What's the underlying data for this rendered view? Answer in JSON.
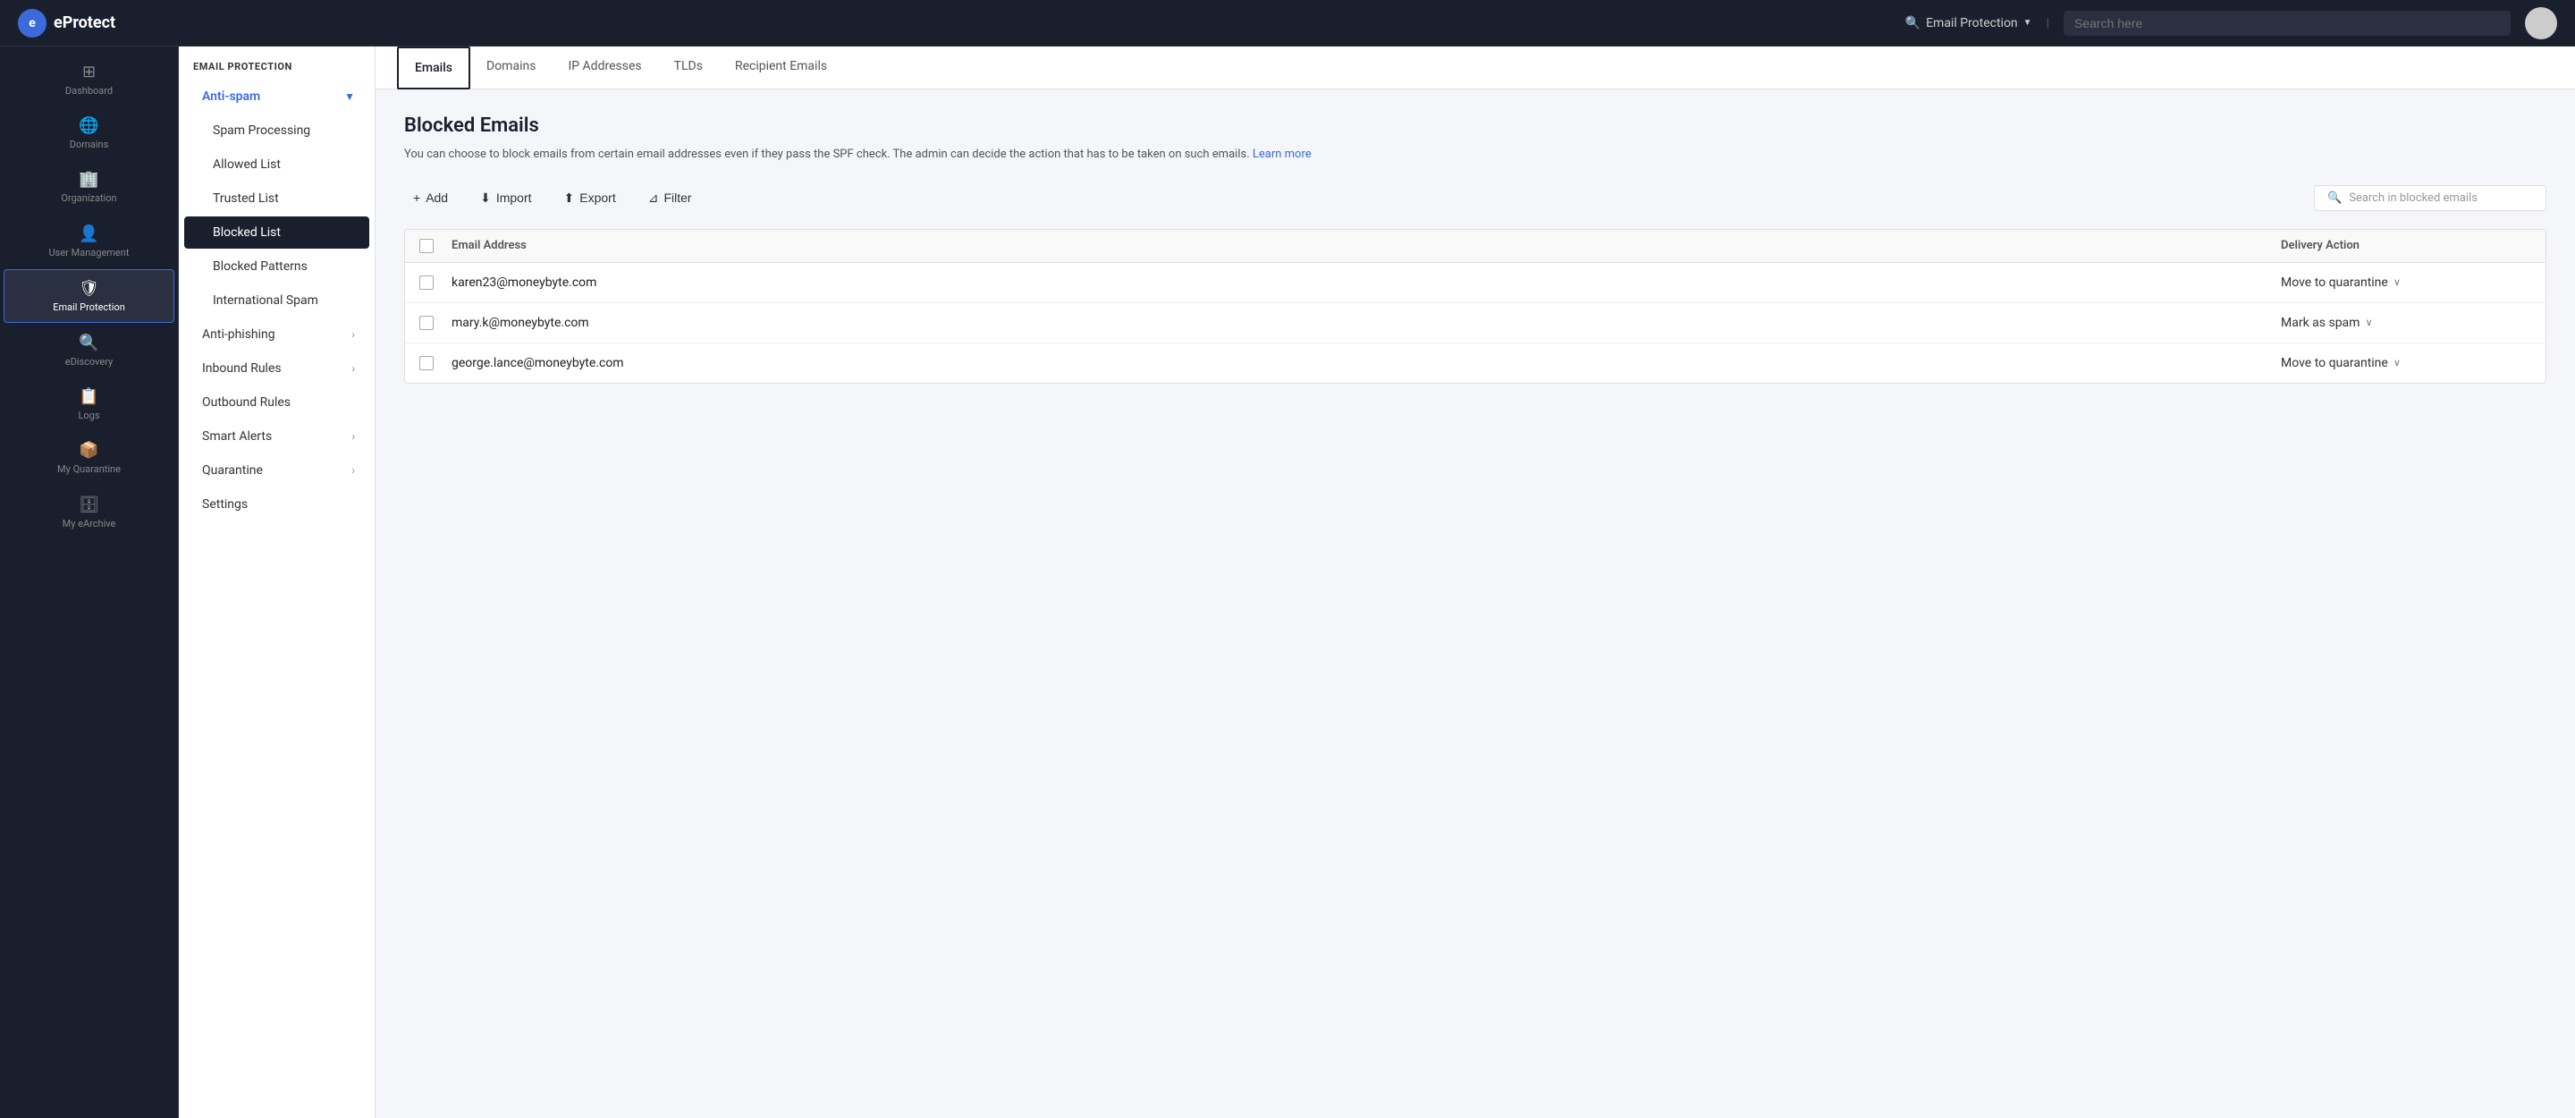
{
  "app": {
    "name": "eProtect",
    "logo_char": "e"
  },
  "topnav": {
    "search_context": "Email Protection",
    "search_placeholder": "Search here"
  },
  "sidebar": {
    "items": [
      {
        "id": "dashboard",
        "label": "Dashboard",
        "icon": "⊞"
      },
      {
        "id": "domains",
        "label": "Domains",
        "icon": "🌐"
      },
      {
        "id": "organization",
        "label": "Organization",
        "icon": "🏢"
      },
      {
        "id": "user-management",
        "label": "User Management",
        "icon": "👤"
      },
      {
        "id": "email-protection",
        "label": "Email Protection",
        "icon": "🛡",
        "active": true
      },
      {
        "id": "ediscovery",
        "label": "eDiscovery",
        "icon": "🔍"
      },
      {
        "id": "logs",
        "label": "Logs",
        "icon": "📋"
      },
      {
        "id": "my-quarantine",
        "label": "My Quarantine",
        "icon": "📦"
      },
      {
        "id": "my-earchive",
        "label": "My eArchive",
        "icon": "🗄"
      }
    ]
  },
  "sub_sidebar": {
    "section_title": "EMAIL PROTECTION",
    "items": [
      {
        "id": "anti-spam",
        "label": "Anti-spam",
        "is_parent": true,
        "expanded": true
      },
      {
        "id": "spam-processing",
        "label": "Spam Processing",
        "indent": true
      },
      {
        "id": "allowed-list",
        "label": "Allowed List",
        "indent": true
      },
      {
        "id": "trusted-list",
        "label": "Trusted List",
        "indent": true
      },
      {
        "id": "blocked-list",
        "label": "Blocked List",
        "indent": true,
        "active": true
      },
      {
        "id": "blocked-patterns",
        "label": "Blocked Patterns",
        "indent": true
      },
      {
        "id": "international-spam",
        "label": "International Spam",
        "indent": true
      },
      {
        "id": "anti-phishing",
        "label": "Anti-phishing",
        "has_chevron": true
      },
      {
        "id": "inbound-rules",
        "label": "Inbound Rules",
        "has_chevron": true
      },
      {
        "id": "outbound-rules",
        "label": "Outbound Rules"
      },
      {
        "id": "smart-alerts",
        "label": "Smart Alerts",
        "has_chevron": true
      },
      {
        "id": "quarantine",
        "label": "Quarantine",
        "has_chevron": true
      },
      {
        "id": "settings",
        "label": "Settings"
      }
    ]
  },
  "tabs": [
    {
      "id": "emails",
      "label": "Emails",
      "active": true
    },
    {
      "id": "domains",
      "label": "Domains"
    },
    {
      "id": "ip-addresses",
      "label": "IP Addresses"
    },
    {
      "id": "tlds",
      "label": "TLDs"
    },
    {
      "id": "recipient-emails",
      "label": "Recipient Emails"
    }
  ],
  "page": {
    "title": "Blocked Emails",
    "description": "You can choose to block emails from certain email addresses even if they pass the SPF check. The admin can decide the action that has to be taken on such emails.",
    "learn_more": "Learn more"
  },
  "toolbar": {
    "add_label": "Add",
    "import_label": "Import",
    "export_label": "Export",
    "filter_label": "Filter",
    "search_placeholder": "Search in blocked emails"
  },
  "table": {
    "columns": [
      {
        "id": "email",
        "label": "Email Address"
      },
      {
        "id": "action",
        "label": "Delivery Action"
      }
    ],
    "rows": [
      {
        "email": "karen23@moneybyte.com",
        "action": "Move to quarantine"
      },
      {
        "email": "mary.k@moneybyte.com",
        "action": "Mark as spam"
      },
      {
        "email": "george.lance@moneybyte.com",
        "action": "Move to quarantine"
      }
    ]
  }
}
